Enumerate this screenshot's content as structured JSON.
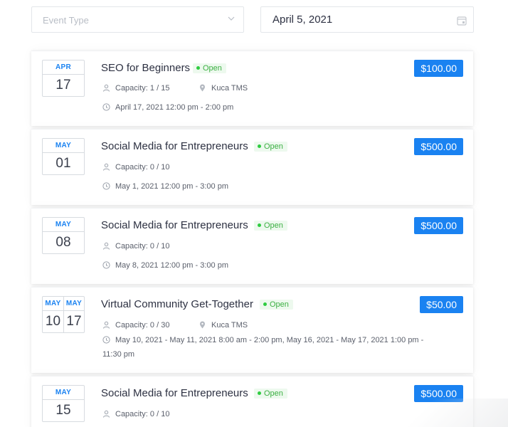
{
  "filters": {
    "event_type_placeholder": "Event Type",
    "date_value": "April 5, 2021"
  },
  "events": [
    {
      "month": "APR",
      "day": "17",
      "title": "SEO for Beginners",
      "status": "Open",
      "price": "$100.00",
      "capacity": "Capacity: 1 / 15",
      "location": "Kuca TMS",
      "datetime": "April 17, 2021 12:00 pm - 2:00 pm"
    },
    {
      "month": "MAY",
      "day": "01",
      "title": "Social Media for Entrepreneurs",
      "status": "Open",
      "price": "$500.00",
      "capacity": "Capacity: 0 / 10",
      "datetime": "May 1, 2021 12:00 pm - 3:00 pm"
    },
    {
      "month": "MAY",
      "day": "08",
      "title": "Social Media for Entrepreneurs",
      "status": "Open",
      "price": "$500.00",
      "capacity": "Capacity: 0 / 10",
      "datetime": "May 8, 2021 12:00 pm - 3:00 pm"
    },
    {
      "month": "MAY",
      "day": "10",
      "month2": "MAY",
      "day2": "17",
      "title": "Virtual Community Get-Together",
      "status": "Open",
      "price": "$50.00",
      "capacity": "Capacity: 0 / 30",
      "location": "Kuca TMS",
      "datetime": "May 10, 2021 - May 11, 2021 8:00 am - 2:00 pm, May 16, 2021 - May 17, 2021 1:00 pm - 11:30 pm"
    },
    {
      "month": "MAY",
      "day": "15",
      "title": "Social Media for Entrepreneurs",
      "status": "Open",
      "price": "$500.00",
      "capacity": "Capacity: 0 / 10"
    }
  ],
  "colors": {
    "accent": "#1a82f1",
    "status_open": "#2ecc40"
  }
}
